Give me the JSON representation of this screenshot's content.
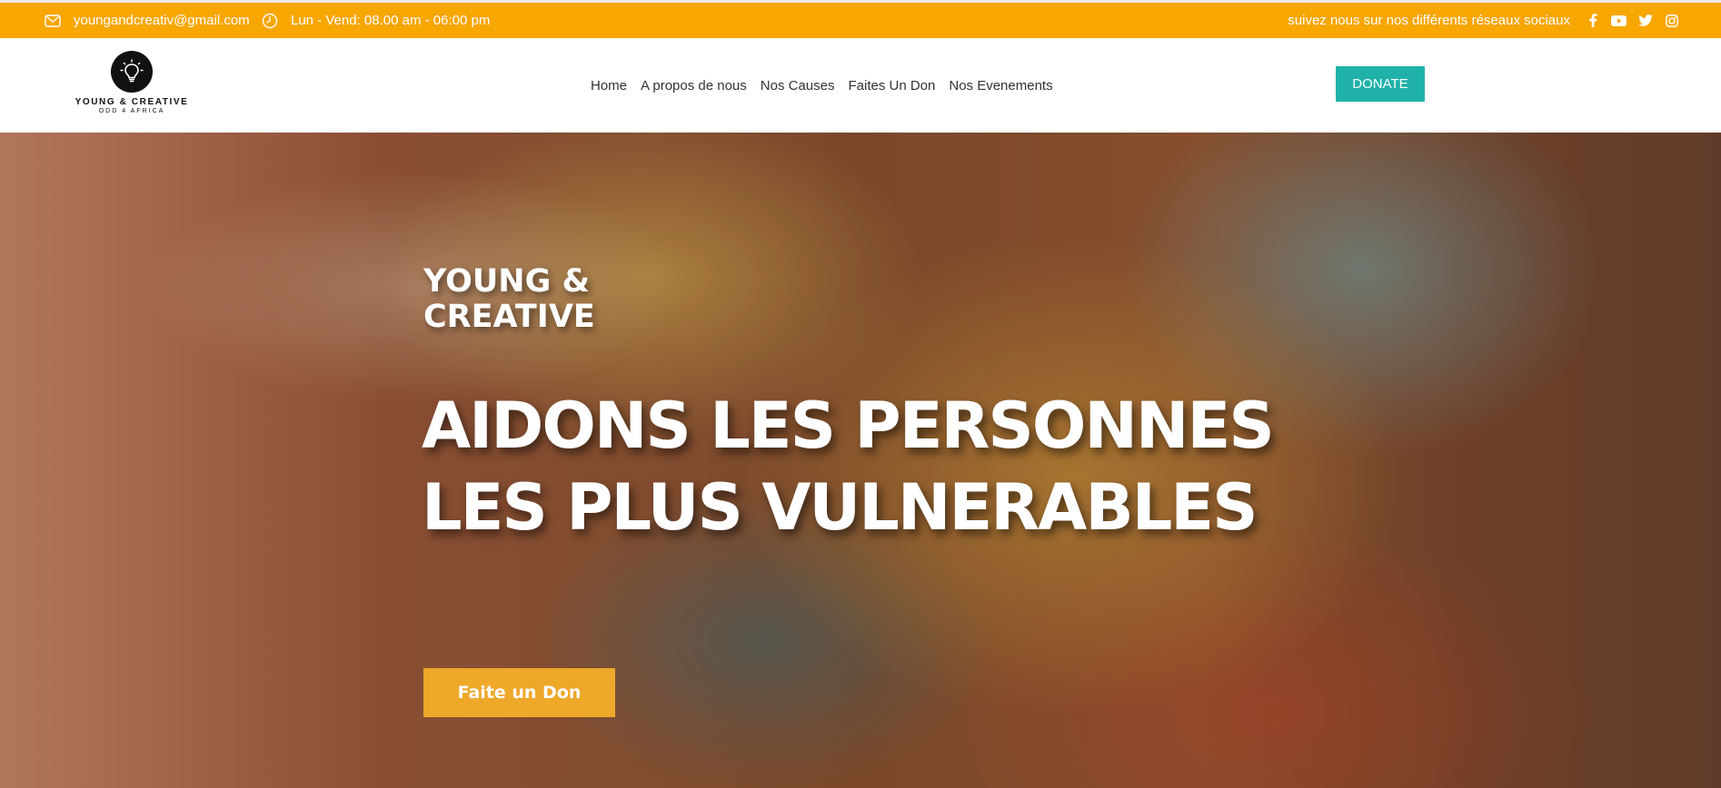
{
  "topbar": {
    "email": "youngandcreativ@gmail.com",
    "hours": "Lun - Vend: 08.00 am - 06:00 pm",
    "follow_text": "suivez nous sur nos différents réseaux sociaux",
    "social_icons": [
      "facebook-icon",
      "youtube-icon",
      "twitter-icon",
      "instagram-icon"
    ],
    "background": "#f8a600"
  },
  "logo": {
    "name": "YOUNG & CREATIVE",
    "tagline": "ODD 4 AFRICA"
  },
  "nav": {
    "items": [
      "Home",
      "A propos de nous",
      "Nos Causes",
      "Faites Un Don",
      "Nos Evenements"
    ]
  },
  "header": {
    "donate_label": "DONATE",
    "donate_color": "#20b2aa"
  },
  "hero": {
    "eyebrow": "YOUNG & CREATIVE",
    "headline": "AIDONS LES PERSONNES LES PLUS VULNERABLES",
    "cta_label": "Faite un Don",
    "cta_color": "#eea82a"
  }
}
